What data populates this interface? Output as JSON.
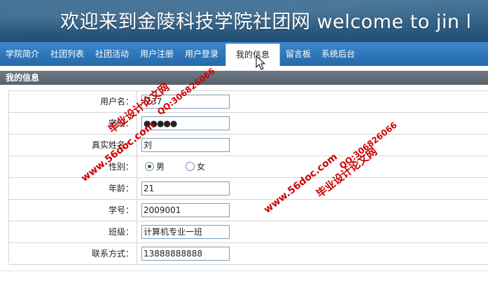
{
  "banner": {
    "title": "欢迎来到金陵科技学院社团网 welcome to jin l"
  },
  "nav": {
    "items": [
      "学院简介",
      "社团列表",
      "社团活动",
      "用户注册",
      "用户登录",
      "我的信息",
      "留言板",
      "系统后台"
    ],
    "active_index": 5
  },
  "section": {
    "title": "我的信息"
  },
  "form": {
    "username_label": "用户名：",
    "username_value": "l237",
    "password_label": "密码：",
    "password_value": "●●●●●",
    "realname_label": "真实姓名：",
    "realname_value": "刘",
    "gender_label": "性别：",
    "gender_male": "男",
    "gender_female": "女",
    "gender_selected": "男",
    "age_label": "年龄：",
    "age_value": "21",
    "student_id_label": "学号：",
    "student_id_value": "2009001",
    "class_label": "班级：",
    "class_value": "计算机专业一班",
    "contact_label": "联系方式：",
    "contact_value": "13888888888"
  },
  "watermarks": {
    "url": "www.56doc.com",
    "qq": "QQ:306826066",
    "cn": "毕业设计论文网"
  },
  "colors": {
    "nav_bg": "#2f78bb",
    "section_bg": "#5f6a75",
    "watermark": "#cc0000"
  }
}
